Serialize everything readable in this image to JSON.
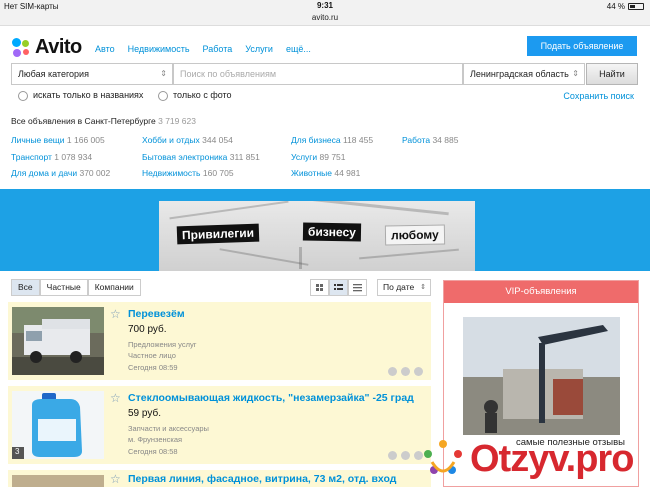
{
  "status_bar": {
    "carrier": "Нет SIM-карты",
    "time": "9:31",
    "battery": "44 %",
    "battery_level": 0.44
  },
  "url": "avito.ru",
  "header": {
    "logo_text": "Avito",
    "nav": [
      "Авто",
      "Недвижимость",
      "Работа",
      "Услуги",
      "ещё..."
    ],
    "post_button": "Подать объявление"
  },
  "search": {
    "category": "Любая категория",
    "query_placeholder": "Поиск по объявлениям",
    "region": "Ленинградская область",
    "find_button": "Найти",
    "only_titles": "искать только в названиях",
    "only_photo": "только с фото",
    "save_search": "Сохранить поиск"
  },
  "all_ads": {
    "label": "Все объявления в Санкт-Петербурге",
    "count": "3 719 623"
  },
  "categories": [
    {
      "name": "Личные вещи",
      "count": "1 166 005"
    },
    {
      "name": "Транспорт",
      "count": "1 078 934"
    },
    {
      "name": "Для дома и дачи",
      "count": "370 002"
    },
    {
      "name": "Хобби и отдых",
      "count": "344 054"
    },
    {
      "name": "Бытовая электроника",
      "count": "311 851"
    },
    {
      "name": "Недвижимость",
      "count": "160 705"
    },
    {
      "name": "Для бизнеса",
      "count": "118 455"
    },
    {
      "name": "Услуги",
      "count": "89 751"
    },
    {
      "name": "Животные",
      "count": "44 981"
    },
    {
      "name": "Работа",
      "count": "34 885"
    }
  ],
  "banner": {
    "words": [
      "Привилегии",
      "бизнесу",
      "любому"
    ]
  },
  "filters": {
    "tabs": [
      "Все",
      "Частные",
      "Компании"
    ],
    "sort": "По дате"
  },
  "listings": [
    {
      "title": "Перевезём",
      "price": "700 руб.",
      "category": "Предложения услуг",
      "seller": "Частное лицо",
      "date": "Сегодня 08:59"
    },
    {
      "title": "Стеклоомывающая жидкость, \"незамерзайка\" -25 град",
      "price": "59 руб.",
      "category": "Запчасти и аксессуары",
      "seller": "м. Фрунзенская",
      "date": "Сегодня 08:58",
      "photo_count": "3"
    },
    {
      "title": "Первая линия, фасадное, витрина, 73 м2, отд. вход"
    }
  ],
  "vip": {
    "header": "VIP-объявления",
    "caption": "самые полезные отзывы"
  },
  "watermark": {
    "text": "Otzyv.pro"
  },
  "colors": {
    "link": "#0091d9",
    "primary_button": "#1c9af0",
    "banner_bg": "#1da1e5",
    "item_bg": "#fdf8d4",
    "vip_header": "#ef6b6b",
    "watermark": "#d7282f"
  }
}
